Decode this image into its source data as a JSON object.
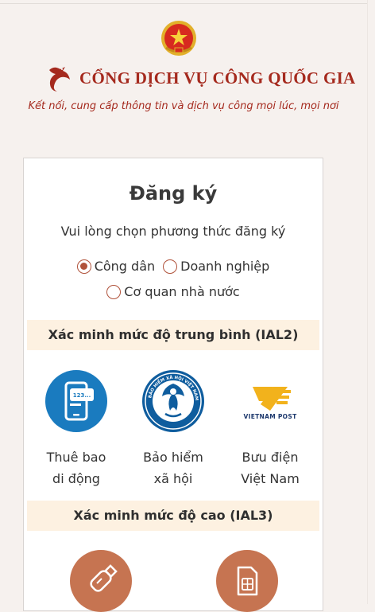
{
  "header": {
    "brand_title": "CỔNG DỊCH VỤ CÔNG QUỐC GIA",
    "tagline": "Kết nối, cung cấp thông tin và dịch vụ công mọi lúc, mọi nơi",
    "emblem_icon": "national-emblem-icon",
    "crane_icon": "crane-logo-icon"
  },
  "register": {
    "title": "Đăng ký",
    "subtitle": "Vui lòng chọn phương thức đăng ký",
    "options": [
      {
        "label": "Công dân",
        "selected": true
      },
      {
        "label": "Doanh nghiệp",
        "selected": false
      },
      {
        "label": "Cơ quan nhà nước",
        "selected": false
      }
    ]
  },
  "ial2": {
    "title": "Xác minh mức độ trung bình (IAL2)",
    "methods": [
      {
        "line1": "Thuê bao",
        "line2": "di động",
        "icon": "mobile-subscription-icon"
      },
      {
        "line1": "Bảo hiểm",
        "line2": "xã hội",
        "icon": "social-insurance-icon"
      },
      {
        "line1": "Bưu điện",
        "line2": "Việt Nam",
        "icon": "vietnam-post-icon"
      }
    ],
    "post_logo_text": "VIETNAM POST",
    "insurance_ring_text": "BẢO HIỂM XÃ HỘI VIỆT NAM",
    "phone_screen_text": "123..."
  },
  "ial3": {
    "title": "Xác minh mức độ cao (IAL3)",
    "methods": [
      {
        "icon": "usb-token-icon"
      },
      {
        "icon": "sim-card-icon"
      }
    ]
  },
  "colors": {
    "brand_red": "#a52a1e",
    "accent": "#b0523a",
    "band_bg": "#fdf1e1",
    "ial3_icon_bg": "#c67451",
    "phone_icon_bg": "#1a7bbf",
    "post_yellow": "#f2b21c"
  }
}
